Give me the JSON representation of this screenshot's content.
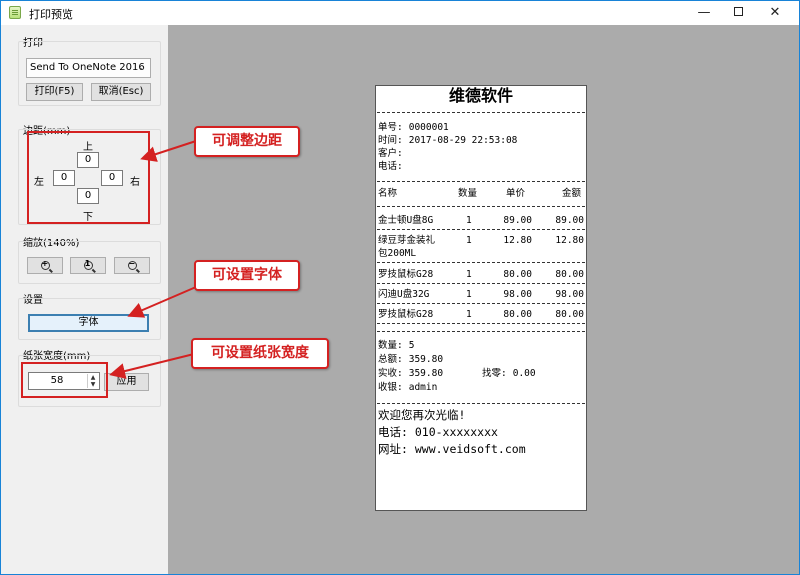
{
  "window": {
    "title": "打印预览",
    "app_icon": "app-icon",
    "minimize_icon": "minimize-icon",
    "maximize_icon": "maximize-icon",
    "close_icon": "close-icon",
    "minimize": "—",
    "close": "✕"
  },
  "print_group": {
    "label": "打印",
    "printer_selected": "Send To OneNote 2016",
    "print_button": "打印(F5)",
    "cancel_button": "取消(Esc)"
  },
  "margin_group": {
    "label": "边距(mm)",
    "top_label": "上",
    "bottom_label": "下",
    "left_label": "左",
    "right_label": "右",
    "top": "0",
    "bottom": "0",
    "left": "0",
    "right": "0"
  },
  "zoom_group": {
    "label": "缩放(140%)",
    "zoom_in_icon": "zoom-in-icon",
    "zoom_reset_icon": "zoom-reset-icon",
    "zoom_out_icon": "zoom-out-icon",
    "zoom_in_glyph": "+",
    "zoom_reset_glyph": "1",
    "zoom_out_glyph": "−"
  },
  "settings_group": {
    "label": "设置",
    "font_button": "字体"
  },
  "paper_group": {
    "label": "纸张宽度(mm)",
    "width_value": "58",
    "apply_button": "应用"
  },
  "callouts": {
    "margin": "可调整边距",
    "font": "可设置字体",
    "paper": "可设置纸张宽度"
  },
  "receipt": {
    "title": "维德软件",
    "order_no_label": "单号:",
    "order_no": "0000001",
    "time_label": "时间:",
    "time": "2017-08-29 22:53:08",
    "customer_label": "客户:",
    "phone_label": "电话:",
    "headers": [
      "名称",
      "数量",
      "单价",
      "金额"
    ],
    "items": [
      {
        "name": "金士顿U盘8G",
        "name2": "",
        "qty": "1",
        "price": "89.00",
        "amount": "89.00"
      },
      {
        "name": "绿豆芽金装礼",
        "name2": "包200ML",
        "qty": "1",
        "price": "12.80",
        "amount": "12.80"
      },
      {
        "name": "罗技鼠标G28",
        "name2": "",
        "qty": "1",
        "price": "80.00",
        "amount": "80.00"
      },
      {
        "name": "闪迪U盘32G",
        "name2": "",
        "qty": "1",
        "price": "98.00",
        "amount": "98.00"
      },
      {
        "name": "罗技鼠标G28",
        "name2": "",
        "qty": "1",
        "price": "80.00",
        "amount": "80.00"
      }
    ],
    "count_label": "数量:",
    "count": "5",
    "total_label": "总额:",
    "total": "359.80",
    "paid_label": "实收:",
    "paid": "359.80",
    "change_label": "找零:",
    "change": "0.00",
    "cashier_label": "收银:",
    "cashier": "admin",
    "footer_welcome": "欢迎您再次光临!",
    "footer_phone": "电话: 010-xxxxxxxx",
    "footer_site": "网址: www.veidsoft.com"
  }
}
